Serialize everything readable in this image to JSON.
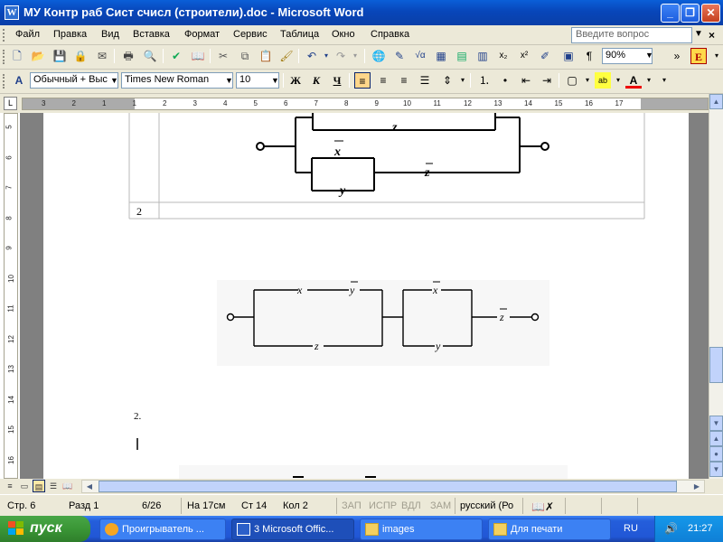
{
  "window": {
    "title": "МУ Контр раб Сист счисл (строители).doc - Microsoft Word",
    "app_letter": "W"
  },
  "menu": {
    "items": [
      "Файл",
      "Правка",
      "Вид",
      "Вставка",
      "Формат",
      "Сервис",
      "Таблица",
      "Окно",
      "Справка"
    ],
    "ask_placeholder": "Введите вопрос"
  },
  "toolbar": {
    "zoom": "90%"
  },
  "formatting": {
    "style": "Обычный + Выс",
    "font": "Times New Roman",
    "size": "10",
    "bold_label": "Ж",
    "italic_label": "К",
    "underline_label": "Ч"
  },
  "ruler": {
    "numbers": [
      "3",
      "2",
      "1",
      "1",
      "2",
      "3",
      "4",
      "5",
      "6",
      "7",
      "8",
      "9",
      "10",
      "11",
      "12",
      "13",
      "14",
      "15",
      "16",
      "17"
    ],
    "vertical_numbers": [
      "5",
      "6",
      "7",
      "8",
      "9",
      "10",
      "11",
      "12",
      "13",
      "14",
      "15",
      "16"
    ]
  },
  "document": {
    "table_row_number": "2",
    "diagram1": {
      "labels": [
        "z",
        "x",
        "y",
        "z"
      ]
    },
    "diagram2": {
      "labels": [
        "x",
        "y",
        "z",
        "x",
        "y",
        "z"
      ]
    },
    "paragraph_number": "2."
  },
  "status": {
    "page": "Стр. 6",
    "section": "Разд 1",
    "pages": "6/26",
    "at": "На 17см",
    "line": "Ст 14",
    "col": "Кол 2",
    "rec": "ЗАП",
    "trk": "ИСПР",
    "ext": "ВДЛ",
    "ovr": "ЗАМ",
    "language": "русский (Ро"
  },
  "taskbar": {
    "start_label": "пуск",
    "tasks": [
      "Проигрыватель ...",
      "3 Microsoft Offic...",
      "images",
      "Для печати"
    ],
    "lang": "RU",
    "clock": "21:27"
  },
  "colors": {
    "title_bar": "#0a5fd8",
    "taskbar": "#245edb",
    "start_button": "#3a9636"
  }
}
